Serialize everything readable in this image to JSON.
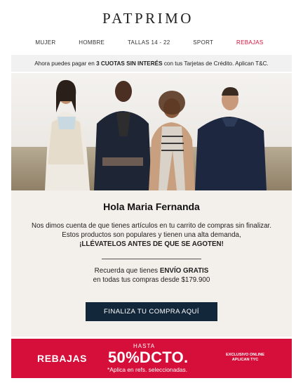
{
  "brand": {
    "logo": "PATPRIMO"
  },
  "nav": {
    "items": [
      {
        "label": "MUJER"
      },
      {
        "label": "HOMBRE"
      },
      {
        "label": "TALLAS 14 - 22"
      },
      {
        "label": "SPORT"
      },
      {
        "label": "REBAJAS"
      }
    ]
  },
  "promo": {
    "text_before": "Ahora puedes pagar en ",
    "highlight": "3 CUOTAS SIN INTERÉS",
    "text_after": " con tus Tarjetas de Crédito. Aplican T&C."
  },
  "hero": {
    "image_alt": "Cuatro modelos con ropa de invierno en un campo"
  },
  "email": {
    "greeting": "Hola Maria Fernanda",
    "line1": "Nos dimos cuenta de que tienes artículos en tu carrito de compras sin finalizar.",
    "line2": "Estos productos son populares y tienen una alta demanda,",
    "line3": "¡LLÉVATELOS ANTES DE QUE SE AGOTEN!",
    "ship_before": "Recuerda que tienes ",
    "ship_highlight": "ENVÍO GRATIS",
    "ship_line2": "en todas tus compras desde $179.900",
    "cta": "FINALIZA TU COMPRA AQUÍ"
  },
  "sale": {
    "label": "REBAJAS",
    "hasta": "HASTA",
    "discount": "50%DCTO.",
    "note": "*Aplica en refs. seleccionadas.",
    "exclusive_line1": "EXCLUSIVO ONLINE",
    "exclusive_line2": "APLICAN TYC"
  },
  "colors": {
    "sale_red": "#d50f3a",
    "cta_navy": "#13273a",
    "content_bg": "#f3efea"
  }
}
